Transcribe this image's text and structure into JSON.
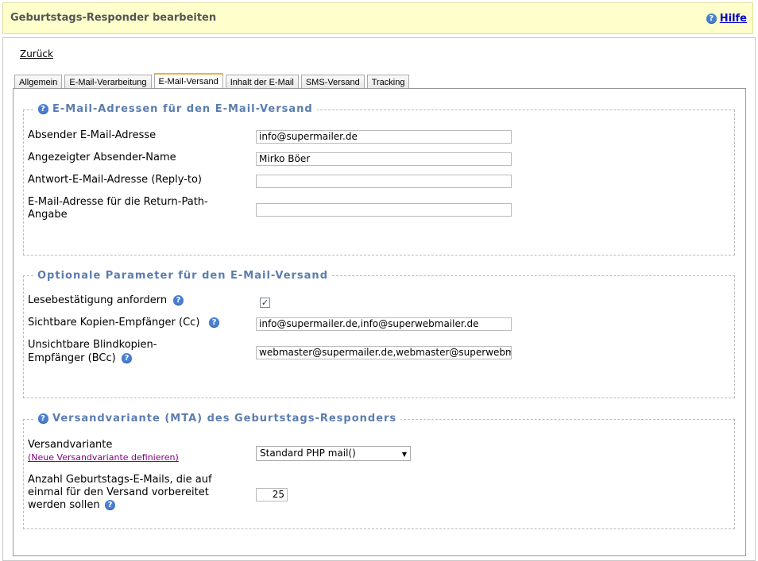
{
  "header": {
    "title": "Geburtstags-Responder bearbeiten",
    "help_label": "Hilfe"
  },
  "nav": {
    "back_label": "Zurück"
  },
  "tabs": [
    {
      "label": "Allgemein"
    },
    {
      "label": "E-Mail-Verarbeitung"
    },
    {
      "label": "E-Mail-Versand",
      "active": true
    },
    {
      "label": "Inhalt der E-Mail"
    },
    {
      "label": "SMS-Versand"
    },
    {
      "label": "Tracking"
    }
  ],
  "section1": {
    "legend": "E-Mail-Adressen für den E-Mail-Versand",
    "sender_label": "Absender E-Mail-Adresse",
    "sender_value": "info@supermailer.de",
    "sender_name_label": "Angezeigter Absender-Name",
    "sender_name_value": "Mirko Böer",
    "reply_label": "Antwort-E-Mail-Adresse (Reply-to)",
    "reply_value": "",
    "return_path_label_1": "E-Mail-Adresse für die Return-Path-",
    "return_path_label_2": "Angabe",
    "return_path_value": ""
  },
  "section2": {
    "legend": "Optionale Parameter für den E-Mail-Versand",
    "read_receipt_label": "Lesebestätigung anfordern",
    "read_receipt_checked": "✓",
    "cc_label": "Sichtbare Kopien-Empfänger (Cc)",
    "cc_value": "info@supermailer.de,info@superwebmailer.de",
    "bcc_label_1": "Unsichtbare Blindkopien-",
    "bcc_label_2": "Empfänger (BCc)",
    "bcc_value": "webmaster@supermailer.de,webmaster@superwebmailer.de"
  },
  "section3": {
    "legend": "Versandvariante (MTA) des Geburtstags-Responders",
    "mta_label": "Versandvariante",
    "mta_link": "(Neue Versandvariante definieren)",
    "mta_selected": "Standard PHP mail()",
    "count_label_1": "Anzahl Geburtstags-E-Mails, die auf",
    "count_label_2": "einmal für den Versand vorbereitet",
    "count_label_3": "werden sollen",
    "count_value": "25"
  },
  "colors": {
    "header_bg": "#ffffcc",
    "legend": "#5b7dae",
    "tab_active_top": "#f0b040",
    "help_link": "#0000cc",
    "visited_link": "#800080"
  },
  "icons": {
    "help": "question-circle-icon"
  }
}
